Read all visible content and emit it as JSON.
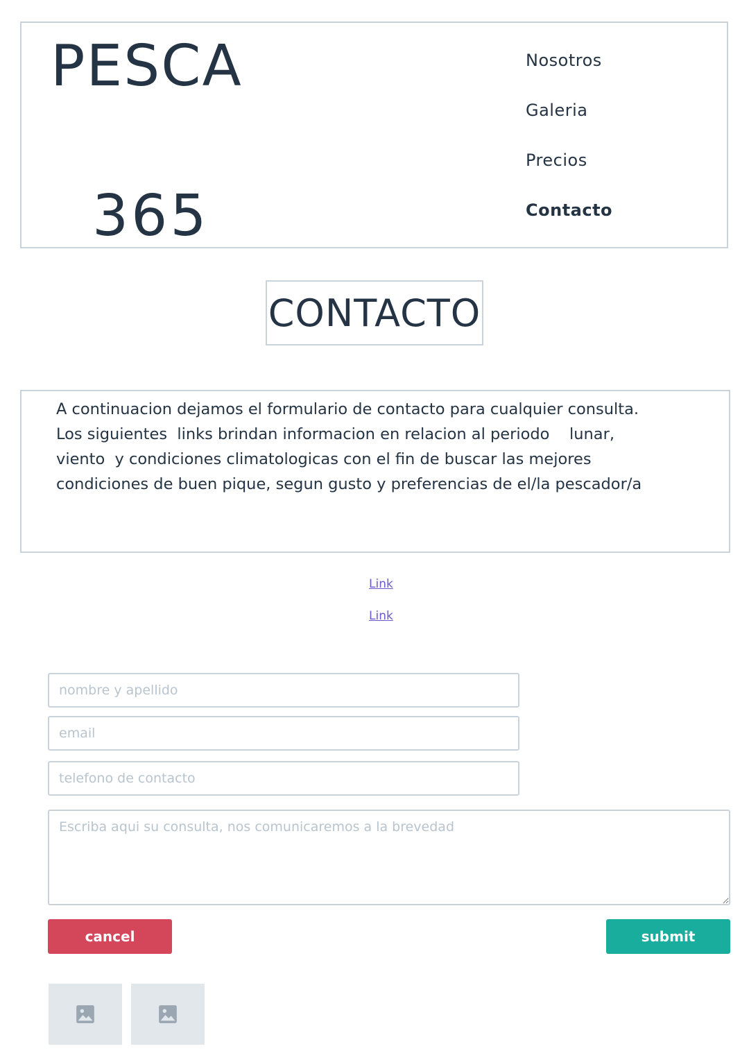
{
  "header": {
    "logo_top": "PESCA",
    "logo_bottom": "365",
    "nav": [
      {
        "label": "Nosotros",
        "active": false
      },
      {
        "label": "Galeria",
        "active": false
      },
      {
        "label": "Precios",
        "active": false
      },
      {
        "label": "Contacto",
        "active": true
      }
    ]
  },
  "page": {
    "title": "CONTACTO",
    "intro": "A continuacion dejamos el formulario de contacto para cualquier consulta.\nLos siguientes  links brindan informacion en relacion al periodo    lunar, viento  y condiciones climatologicas con el fin de buscar las mejores condiciones de buen pique, segun gusto y preferencias de el/la pescador/a"
  },
  "links": [
    {
      "label": "Link"
    },
    {
      "label": "Link"
    }
  ],
  "form": {
    "name_placeholder": "nombre y apellido",
    "email_placeholder": "email",
    "phone_placeholder": "telefono de contacto",
    "message_placeholder": "Escriba aqui su consulta, nos comunicaremos a la brevedad",
    "cancel_label": "cancel",
    "submit_label": "submit"
  },
  "colors": {
    "text": "#243444",
    "border": "#c8d3dc",
    "link": "#6a5acd",
    "cancel": "#d4475b",
    "submit": "#18ad9c",
    "placeholder_image": "#e2e7ec"
  },
  "gallery": [
    {
      "icon": "image-icon"
    },
    {
      "icon": "image-icon"
    }
  ]
}
